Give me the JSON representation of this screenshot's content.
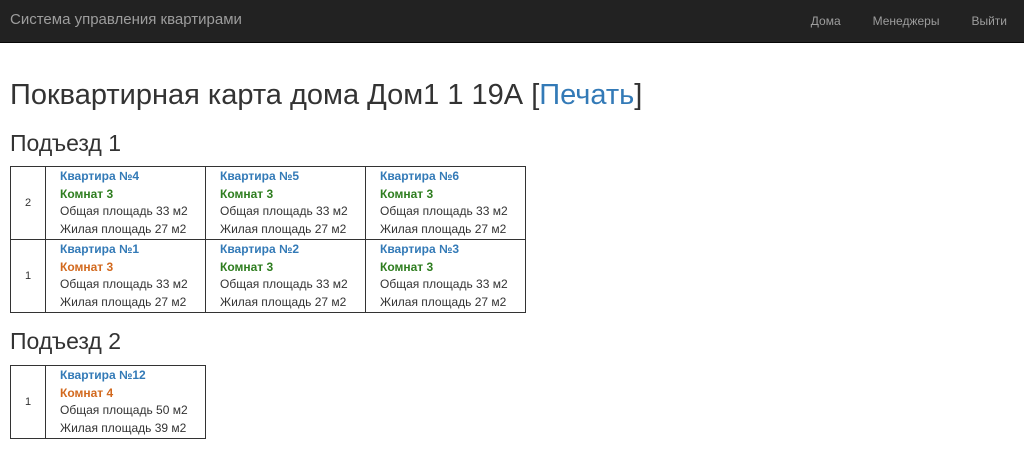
{
  "navbar": {
    "brand": "Система управления квартирами",
    "links": [
      "Дома",
      "Менеджеры",
      "Выйти"
    ]
  },
  "page": {
    "title_prefix": "Поквартирная карта дома Дом1 1 19А [",
    "print_label": "Печать",
    "title_suffix": "]"
  },
  "colors": {
    "rooms_green": "#2e7d1f",
    "rooms_orange": "#d2691e"
  },
  "entrances": [
    {
      "title": "Подъезд 1",
      "floors": [
        {
          "floor": "2",
          "apartments": [
            {
              "title": "Квартира №4",
              "rooms": "Комнат 3",
              "rooms_status": "green",
              "total_area": "Общая площадь 33 м2",
              "living_area": "Жилая площадь 27 м2"
            },
            {
              "title": "Квартира №5",
              "rooms": "Комнат 3",
              "rooms_status": "green",
              "total_area": "Общая площадь 33 м2",
              "living_area": "Жилая площадь 27 м2"
            },
            {
              "title": "Квартира №6",
              "rooms": "Комнат 3",
              "rooms_status": "green",
              "total_area": "Общая площадь 33 м2",
              "living_area": "Жилая площадь 27 м2"
            }
          ]
        },
        {
          "floor": "1",
          "apartments": [
            {
              "title": "Квартира №1",
              "rooms": "Комнат 3",
              "rooms_status": "orange",
              "total_area": "Общая площадь 33 м2",
              "living_area": "Жилая площадь 27 м2"
            },
            {
              "title": "Квартира №2",
              "rooms": "Комнат 3",
              "rooms_status": "green",
              "total_area": "Общая площадь 33 м2",
              "living_area": "Жилая площадь 27 м2"
            },
            {
              "title": "Квартира №3",
              "rooms": "Комнат 3",
              "rooms_status": "green",
              "total_area": "Общая площадь 33 м2",
              "living_area": "Жилая площадь 27 м2"
            }
          ]
        }
      ]
    },
    {
      "title": "Подъезд 2",
      "floors": [
        {
          "floor": "1",
          "apartments": [
            {
              "title": "Квартира №12",
              "rooms": "Комнат 4",
              "rooms_status": "orange",
              "total_area": "Общая площадь 50 м2",
              "living_area": "Жилая площадь 39 м2"
            }
          ]
        }
      ]
    }
  ]
}
